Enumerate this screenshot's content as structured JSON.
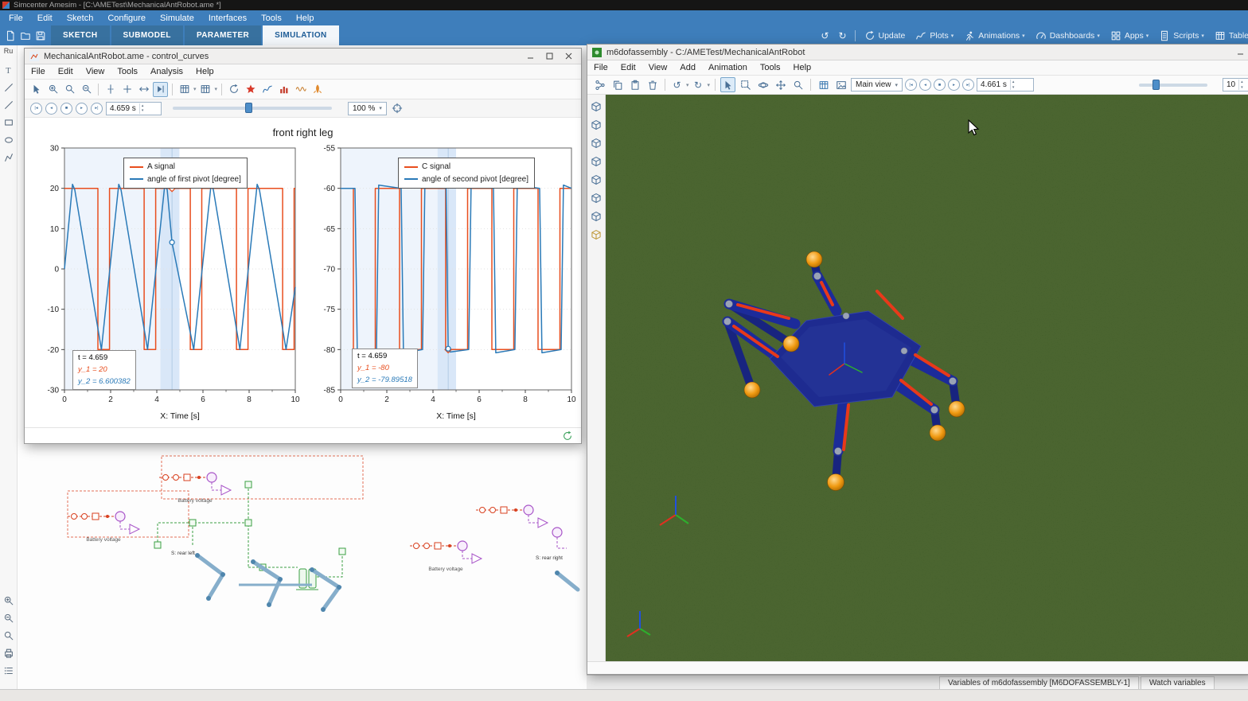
{
  "app": {
    "title": "Simcenter Amesim - [C:\\AMETest\\MechanicalAntRobot.ame *]",
    "menu": [
      "File",
      "Edit",
      "Sketch",
      "Configure",
      "Simulate",
      "Interfaces",
      "Tools",
      "Help"
    ],
    "mode_tabs": [
      "SKETCH",
      "SUBMODEL",
      "PARAMETER",
      "SIMULATION"
    ],
    "active_mode_tab": "SIMULATION",
    "right_tools": {
      "update": "Update",
      "plots": "Plots",
      "animations": "Animations",
      "dashboards": "Dashboards",
      "apps": "Apps",
      "scripts": "Scripts",
      "table": "Table"
    },
    "left_panel_tab": "Ru",
    "colors": {
      "menubar": "#3e7ebb",
      "active_tab_text": "#1d5c96",
      "titlebar": "#151515"
    }
  },
  "plot_window": {
    "title": "MechanicalAntRobot.ame - control_curves",
    "menu": [
      "File",
      "Edit",
      "View",
      "Tools",
      "Analysis",
      "Help"
    ],
    "time_value": "4.659 s",
    "zoom_value": "100 %"
  },
  "anim_window": {
    "title": "m6dofassembly - C:/AMETest/MechanicalAntRobot",
    "menu": [
      "File",
      "Edit",
      "View",
      "Add",
      "Animation",
      "Tools",
      "Help"
    ],
    "view_select": "Main view",
    "time_value": "4.661 s",
    "speed_value": "10"
  },
  "sketch": {
    "labels": [
      "Battery voltage",
      "Battery voltage",
      "Battery voltage",
      "S: rear left",
      "S: rear right"
    ]
  },
  "bottom_tabs": [
    "Variables of m6dofassembly [M6DOFASSEMBLY-1]",
    "Watch variables"
  ],
  "chart_data": [
    {
      "type": "line",
      "title": "front right leg",
      "xlabel": "X: Time [s]",
      "xlim": [
        0,
        10
      ],
      "ylim": [
        -30,
        30
      ],
      "xticks": [
        0,
        2,
        4,
        6,
        8,
        10
      ],
      "yticks": [
        30,
        20,
        10,
        0,
        -10,
        -20,
        -30
      ],
      "grid": true,
      "legend_position": "top",
      "cursor_time": 4.659,
      "cursor_values": [
        20,
        6.600382
      ],
      "highlight_band": [
        4.16,
        4.98
      ],
      "tooltip": [
        "t = 4.659",
        "y_1 = 20",
        "y_2 = 6.600382"
      ],
      "series": [
        {
          "name": "A signal",
          "color": "#e84e1e",
          "points": [
            [
              0,
              20
            ],
            [
              1.45,
              20
            ],
            [
              1.45,
              -20
            ],
            [
              1.95,
              -20
            ],
            [
              1.95,
              20
            ],
            [
              3.45,
              20
            ],
            [
              3.45,
              -20
            ],
            [
              3.95,
              -20
            ],
            [
              3.95,
              20
            ],
            [
              5.45,
              20
            ],
            [
              5.45,
              -20
            ],
            [
              5.95,
              -20
            ],
            [
              5.95,
              20
            ],
            [
              7.45,
              20
            ],
            [
              7.45,
              -20
            ],
            [
              7.95,
              -20
            ],
            [
              7.95,
              20
            ],
            [
              9.45,
              20
            ],
            [
              9.45,
              -20
            ],
            [
              9.95,
              -20
            ],
            [
              9.95,
              20
            ],
            [
              10,
              20
            ]
          ]
        },
        {
          "name": "angle of first pivot [degree]",
          "color": "#2a7ab8",
          "points": [
            [
              0,
              0
            ],
            [
              0.35,
              21
            ],
            [
              0.45,
              19.6
            ],
            [
              1.6,
              -20
            ],
            [
              2.35,
              21
            ],
            [
              2.45,
              19.6
            ],
            [
              3.6,
              -20
            ],
            [
              4.35,
              21
            ],
            [
              4.45,
              19.6
            ],
            [
              4.659,
              6.6
            ],
            [
              5.6,
              -20
            ],
            [
              6.35,
              21
            ],
            [
              6.45,
              19.6
            ],
            [
              7.6,
              -20
            ],
            [
              8.35,
              21
            ],
            [
              8.45,
              19.6
            ],
            [
              9.6,
              -20
            ],
            [
              10,
              -4.5
            ]
          ]
        }
      ]
    },
    {
      "type": "line",
      "title": "",
      "xlabel": "X: Time [s]",
      "xlim": [
        0,
        10
      ],
      "ylim": [
        -85,
        -55
      ],
      "xticks": [
        0,
        2,
        4,
        6,
        8,
        10
      ],
      "yticks": [
        -55,
        -60,
        -65,
        -70,
        -75,
        -80,
        -85
      ],
      "grid": true,
      "legend_position": "top",
      "cursor_time": 4.659,
      "cursor_values": [
        -80,
        -79.89518
      ],
      "highlight_band": [
        4.2,
        5.0
      ],
      "tooltip": [
        "t = 4.659",
        "y_1 = -80",
        "y_2 = -79.89518"
      ],
      "series": [
        {
          "name": "C signal",
          "color": "#e84e1e",
          "points": [
            [
              0,
              -60
            ],
            [
              0.55,
              -60
            ],
            [
              0.55,
              -80
            ],
            [
              1.5,
              -80
            ],
            [
              1.5,
              -60
            ],
            [
              2.55,
              -60
            ],
            [
              2.55,
              -80
            ],
            [
              3.5,
              -80
            ],
            [
              3.5,
              -60
            ],
            [
              4.55,
              -60
            ],
            [
              4.55,
              -80
            ],
            [
              5.5,
              -80
            ],
            [
              5.5,
              -60
            ],
            [
              6.55,
              -60
            ],
            [
              6.55,
              -80
            ],
            [
              7.5,
              -80
            ],
            [
              7.5,
              -60
            ],
            [
              8.55,
              -60
            ],
            [
              8.55,
              -80
            ],
            [
              9.5,
              -80
            ],
            [
              9.5,
              -60
            ],
            [
              10,
              -60
            ]
          ]
        },
        {
          "name": "angle of second pivot [degree]",
          "color": "#2a7ab8",
          "points": [
            [
              0,
              -60
            ],
            [
              0.62,
              -60
            ],
            [
              0.72,
              -80.4
            ],
            [
              1.55,
              -80
            ],
            [
              1.65,
              -59.6
            ],
            [
              2.62,
              -60
            ],
            [
              2.72,
              -80.4
            ],
            [
              3.55,
              -80
            ],
            [
              3.65,
              -59.6
            ],
            [
              4.57,
              -60
            ],
            [
              4.659,
              -79.89518
            ],
            [
              4.75,
              -80.3
            ],
            [
              5.55,
              -80
            ],
            [
              5.65,
              -59.6
            ],
            [
              6.62,
              -60
            ],
            [
              6.72,
              -80.4
            ],
            [
              7.55,
              -80
            ],
            [
              7.65,
              -59.6
            ],
            [
              8.62,
              -60
            ],
            [
              8.72,
              -80.4
            ],
            [
              9.55,
              -80
            ],
            [
              9.65,
              -59.6
            ],
            [
              10,
              -60
            ]
          ]
        }
      ]
    }
  ]
}
